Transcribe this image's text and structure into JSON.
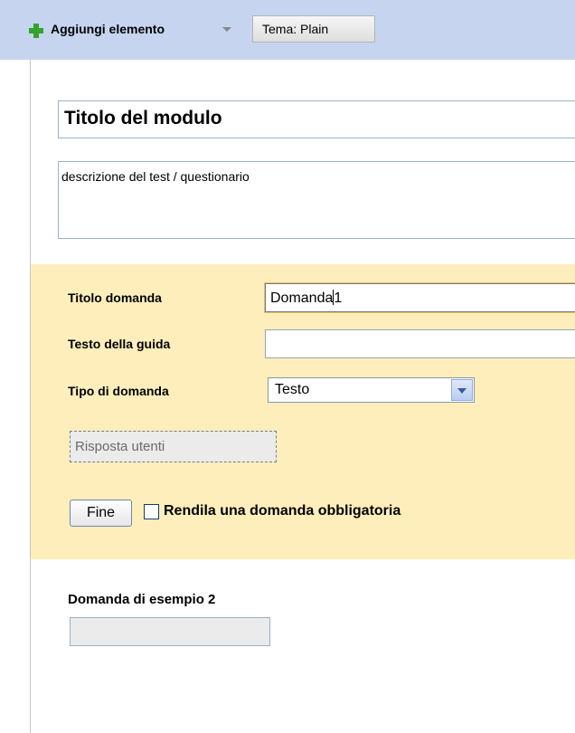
{
  "toolbar": {
    "add_item_label": "Aggiungi elemento",
    "theme_label": "Tema:  Plain"
  },
  "form": {
    "title": "Titolo del modulo",
    "description": "descrizione del test / questionario"
  },
  "question_editor": {
    "title_label": "Titolo domanda",
    "title_value": "Domanda",
    "title_value_after_cursor": "1",
    "help_label": "Testo della guida",
    "help_value": "",
    "type_label": "Tipo di domanda",
    "type_value": "Testo",
    "preview_text": "Risposta utenti",
    "done_label": "Fine",
    "required_label": "Rendila una domanda obbligatoria",
    "required_checked": false
  },
  "sample_question": {
    "label": "Domanda di esempio 2"
  },
  "colors": {
    "toolbar_bg": "#c6d4ef",
    "editor_bg": "#fdeebb",
    "add_icon": "#33a32a"
  }
}
